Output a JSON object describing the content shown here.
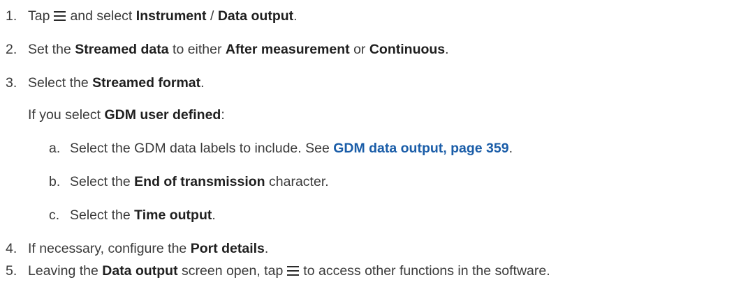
{
  "steps": [
    {
      "number": "1.",
      "parts": {
        "a": "Tap",
        "b": "and select",
        "c": "Instrument",
        "d": "/",
        "e": "Data output",
        "f": "."
      }
    },
    {
      "number": "2.",
      "parts": {
        "a": "Set the",
        "b": "Streamed data",
        "c": "to either",
        "d": "After measurement",
        "e": "or",
        "f": "Continuous",
        "g": "."
      }
    },
    {
      "number": "3.",
      "parts": {
        "a": "Select the",
        "b": "Streamed format",
        "c": "."
      },
      "note": {
        "a": "If you select",
        "b": "GDM user defined",
        "c": ":"
      },
      "substeps": [
        {
          "letter": "a.",
          "parts": {
            "a": "Select the GDM data labels to include. See",
            "link": "GDM data output, page 359",
            "c": "."
          }
        },
        {
          "letter": "b.",
          "parts": {
            "a": "Select the",
            "b": "End of transmission",
            "c": "character."
          }
        },
        {
          "letter": "c.",
          "parts": {
            "a": "Select the",
            "b": "Time output",
            "c": "."
          }
        }
      ]
    },
    {
      "number": "4.",
      "parts": {
        "a": "If necessary, configure the",
        "b": "Port details",
        "c": "."
      }
    },
    {
      "number": "5.",
      "parts": {
        "a": "Leaving the",
        "b": "Data output",
        "c": "screen open, tap",
        "d": "to access other functions in the software."
      }
    }
  ],
  "icons": {
    "menu": "menu-icon"
  },
  "colors": {
    "link": "#1a5da8",
    "text": "#3a3a3a"
  }
}
